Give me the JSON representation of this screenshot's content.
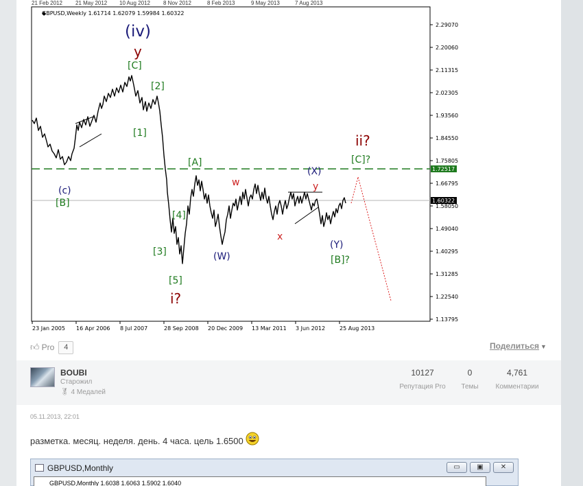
{
  "chart": {
    "symbol_line": "GBPUSD,Weekly  1.61714 1.62079 1.59984 1.60322",
    "top_ticks": [
      "21 Feb 2012",
      "21 May 2012",
      "10 Aug 2012",
      "8 Nov 2012",
      "8 Feb 2013",
      "9 May 2013",
      "7 Aug 2013"
    ],
    "price_labels": [
      "2.29070",
      "2.20060",
      "2.11315",
      "2.02305",
      "1.93560",
      "1.84550",
      "1.75805",
      "1.66795",
      "1.58050",
      "1.49040",
      "1.40295",
      "1.31285",
      "1.22540",
      "1.13795"
    ],
    "current_price": "1.60322",
    "level_price": "1.72517",
    "date_labels": [
      "23 Jan 2005",
      "16 Apr 2006",
      "8 Jul 2007",
      "28 Sep 2008",
      "20 Dec 2009",
      "13 Mar 2011",
      "3 Jun 2012",
      "25 Aug 2013"
    ],
    "wave_labels": {
      "iv": "(iv)",
      "y_big": "y",
      "C_top": "[C]",
      "two": "[2]",
      "one": "[1]",
      "c_small": "(c)",
      "B_left": "[B]",
      "A": "[A]",
      "four": "[4]",
      "three": "[3]",
      "five": "[5]",
      "i_q": "i?",
      "W_paren": "(W)",
      "w_small": "w",
      "x_small": "x",
      "X_paren": "(X)",
      "Y_small": "y",
      "Y_paren": "(Y)",
      "B_q": "[B]?",
      "ii_q": "ii?",
      "C_q": "[C]?"
    },
    "colors": {
      "navy": "#1a1a78",
      "maroon": "#8b0000",
      "green": "#1e7a1e",
      "red": "#cc2222",
      "level_line": "#1e7a1e"
    }
  },
  "post_actions": {
    "pro_label": "Pro",
    "pro_count": "4",
    "share_label": "Поделиться"
  },
  "author": {
    "name": "BOUBI",
    "rank": "Старожил",
    "medals": "4 Медалей",
    "stats": [
      {
        "value": "10127",
        "label": "Репутация Pro"
      },
      {
        "value": "0",
        "label": "Темы"
      },
      {
        "value": "4,761",
        "label": "Комментарии"
      }
    ]
  },
  "post": {
    "date": "05.11.2013, 22:01",
    "text": "разметка. месяц. неделя. день. 4 часа. цель 1.6500"
  },
  "embedded_window": {
    "title": "GBPUSD,Monthly",
    "inner_text": "GBPUSD,Monthly  1.6038 1.6063 1.5902 1.6040",
    "buttons": [
      "▭",
      "▣",
      "✕"
    ]
  }
}
